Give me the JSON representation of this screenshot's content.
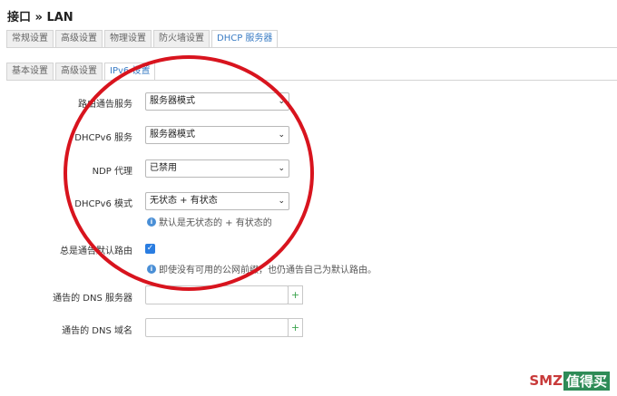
{
  "page": {
    "title": "接口 » LAN"
  },
  "tabs": [
    {
      "label": "常规设置",
      "active": false
    },
    {
      "label": "高级设置",
      "active": false
    },
    {
      "label": "物理设置",
      "active": false
    },
    {
      "label": "防火墙设置",
      "active": false
    },
    {
      "label": "DHCP 服务器",
      "active": true
    }
  ],
  "subtabs": [
    {
      "label": "基本设置",
      "active": false
    },
    {
      "label": "高级设置",
      "active": false
    },
    {
      "label": "IPv6 设置",
      "active": true
    }
  ],
  "fields": {
    "router_advert": {
      "label": "路由通告服务",
      "value": "服务器模式"
    },
    "dhcpv6_service": {
      "label": "DHCPv6 服务",
      "value": "服务器模式"
    },
    "ndp_proxy": {
      "label": "NDP 代理",
      "value": "已禁用"
    },
    "dhcpv6_mode": {
      "label": "DHCPv6 模式",
      "value": "无状态 + 有状态",
      "help": "默认是无状态的 + 有状态的"
    },
    "default_route": {
      "label": "总是通告默认路由",
      "checked": true,
      "help": "即使没有可用的公网前缀，也仍通告自己为默认路由。"
    },
    "dns_servers": {
      "label": "通告的 DNS 服务器",
      "value": ""
    },
    "dns_domains": {
      "label": "通告的 DNS 域名",
      "value": ""
    }
  },
  "watermark": {
    "logo": "SMZ",
    "text": "值得买"
  },
  "colors": {
    "accent": "#3a7cc4",
    "annotation": "#d8141e",
    "checkbox": "#2a7de1",
    "add": "#3da44f"
  }
}
